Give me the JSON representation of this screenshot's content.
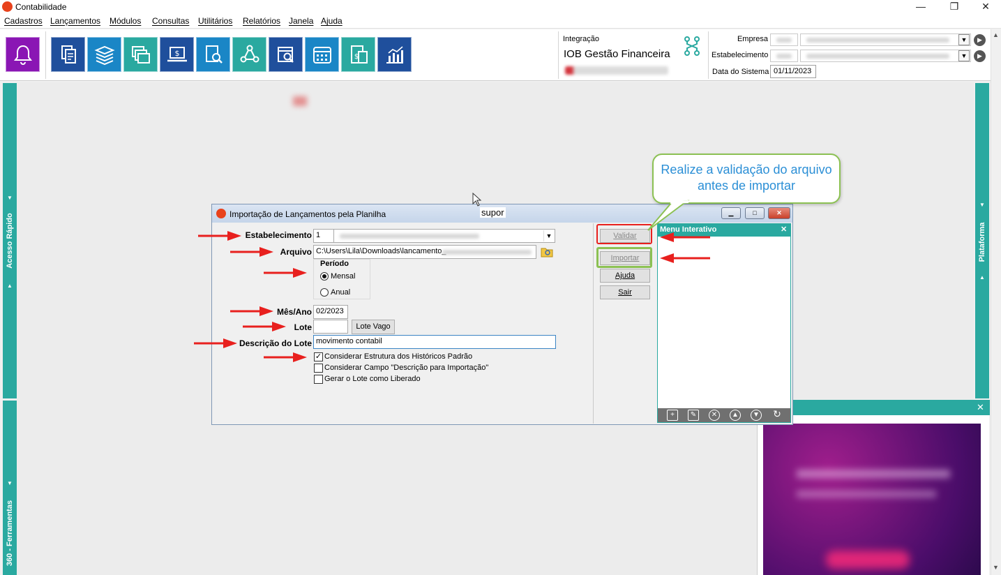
{
  "window": {
    "title": "Contabilidade",
    "minimize": "—",
    "restore": "❐",
    "close": "✕"
  },
  "menu": [
    "Cadastros",
    "Lançamentos",
    "Módulos",
    "Consultas",
    "Utilitários",
    "Relatórios",
    "Janela",
    "Ajuda"
  ],
  "toolbar": {
    "buttons": [
      {
        "icon": "bell-icon",
        "color": "#8a16b4"
      },
      {
        "icon": "documents-icon",
        "color": "#1f4f9c"
      },
      {
        "icon": "stacked-books-icon",
        "color": "#1a86c6"
      },
      {
        "icon": "windows-stack-icon",
        "color": "#2aa9a0"
      },
      {
        "icon": "laptop-dollar-icon",
        "color": "#1f4f9c"
      },
      {
        "icon": "document-search-icon",
        "color": "#1a86c6"
      },
      {
        "icon": "network-search-icon",
        "color": "#2aa9a0"
      },
      {
        "icon": "calendar-search-icon",
        "color": "#1f4f9c"
      },
      {
        "icon": "calendar-grid-icon",
        "color": "#1a86c6"
      },
      {
        "icon": "calculator-dollar-icon",
        "color": "#2aa9a0"
      },
      {
        "icon": "bar-chart-icon",
        "color": "#1f4f9c"
      }
    ]
  },
  "integration": {
    "label": "Integração",
    "name": "IOB Gestão Financeira",
    "icon": "integration-icon"
  },
  "company": {
    "empresa_label": "Empresa",
    "estabelecimento_label": "Estabelecimento",
    "data_label": "Data do Sistema",
    "data_value": "01/11/2023"
  },
  "sidebars": {
    "left_top": "Acesso Rápido",
    "left_bottom": "360 - Ferramentas",
    "right": "Plataforma"
  },
  "dialog": {
    "title": "Importação de Lançamentos pela Planilha",
    "estabelecimento_label": "Estabelecimento",
    "estabelecimento_value": "1",
    "arquivo_label": "Arquivo",
    "arquivo_value": "C:\\Users\\Lila\\Downloads\\lancamento_",
    "periodo_label": "Período",
    "mensal_label": "Mensal",
    "anual_label": "Anual",
    "periodo_selected": "Mensal",
    "mesano_label": "Mês/Ano",
    "mesano_value": "02/2023",
    "lote_label": "Lote",
    "lote_value": "",
    "lote_vago_label": "Lote Vago",
    "descricao_label": "Descrição do Lote",
    "descricao_value": "movimento contabil",
    "check1_label": "Considerar Estrutura dos Históricos Padrão",
    "check1_checked": true,
    "check2_label": "Considerar Campo \"Descrição para Importação\"",
    "check2_checked": false,
    "check3_label": "Gerar o Lote como Liberado",
    "check3_checked": false,
    "validar_label": "Validar",
    "importar_label": "Importar",
    "ajuda_label": "Ajuda",
    "sair_label": "Sair"
  },
  "menu_interativo": {
    "title": "Menu Interativo",
    "tools": [
      "add-icon",
      "edit-icon",
      "remove-icon",
      "move-up-icon",
      "move-down-icon",
      "refresh-icon"
    ]
  },
  "annotations": {
    "callout": "Realize a validação do arquivo antes de importar",
    "cursor_tooltip": "supor",
    "arrow_color": "#e8201e",
    "highlight_red": "#e8201e",
    "highlight_green": "#8cc153"
  },
  "colors": {
    "teal": "#2aa9a0",
    "purple": "#8a16b4",
    "navy": "#1f4f9c",
    "blue": "#1a86c6"
  }
}
